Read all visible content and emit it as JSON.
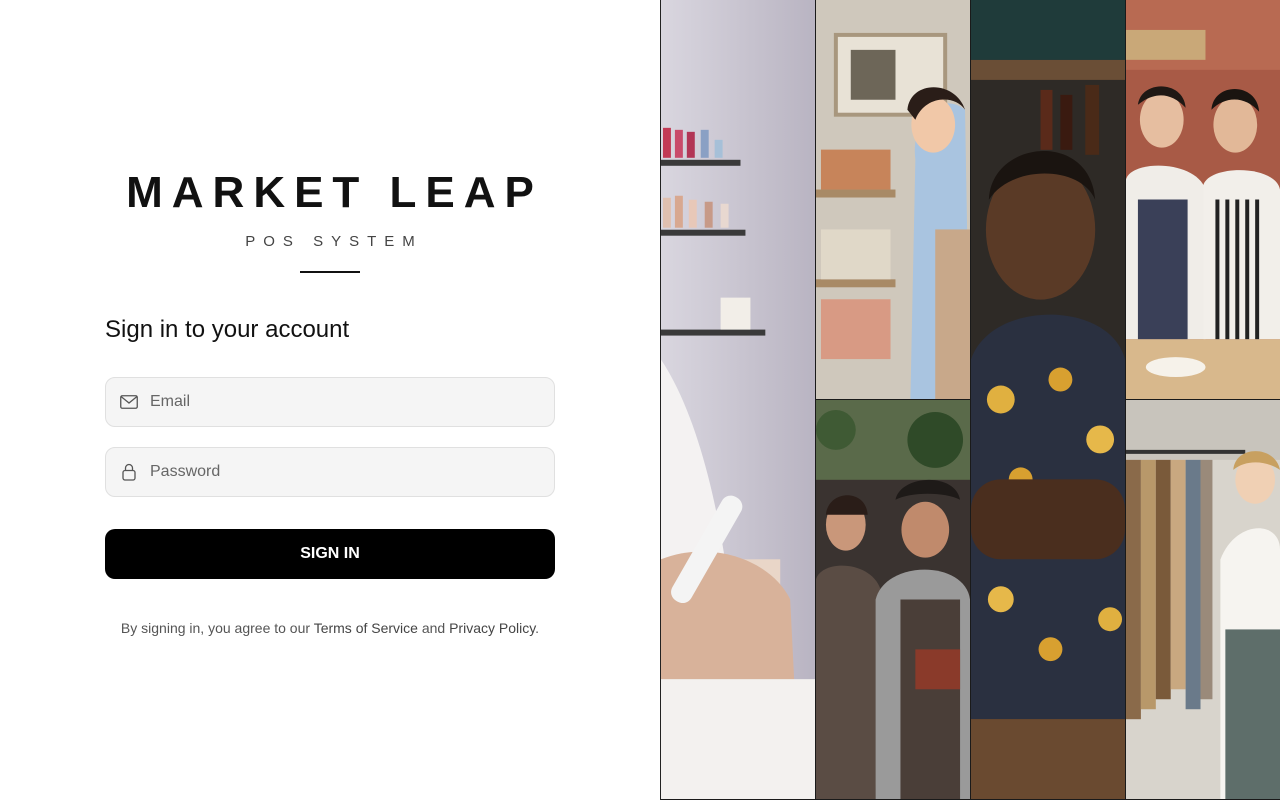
{
  "brand": {
    "title": "MARKET LEAP",
    "subtitle": "POS SYSTEM"
  },
  "form": {
    "heading": "Sign in to your account",
    "email_placeholder": "Email",
    "email_value": "",
    "email_icon": "mail-icon",
    "password_placeholder": "Password",
    "password_value": "",
    "password_icon": "lock-icon",
    "submit_label": "SIGN IN"
  },
  "legal": {
    "prefix": "By signing in, you agree to our ",
    "terms": "Terms of Service",
    "and": " and ",
    "privacy": "Privacy Policy",
    "suffix": "."
  },
  "collage": {
    "tiles": [
      "nail-salon-photo",
      "shop-owner-woman-photo",
      "two-baristas-photo",
      "smiling-man-photo",
      "two-women-aprons-photo",
      "clothing-store-photo"
    ]
  }
}
